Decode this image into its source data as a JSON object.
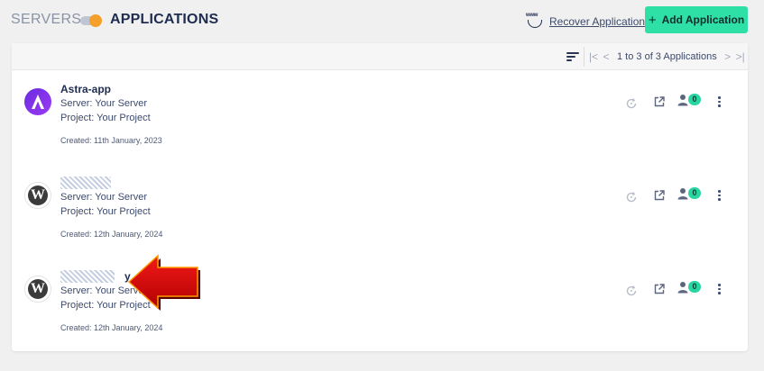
{
  "header": {
    "servers_label": "SERVERS",
    "applications_label": "APPLICATIONS",
    "recover_icon_text": "www",
    "recover_label": "Recover Application",
    "add_button_label": "Add Application",
    "add_button_plus": "+"
  },
  "toolbar": {
    "pagination_info": "1 to 3 of 3 Applications",
    "first_icon": "|<",
    "prev_icon": "<",
    "next_icon": ">",
    "last_icon": ">|"
  },
  "applications": [
    {
      "name": "Astra-app",
      "server": "Server: Your Server",
      "project": "Project: Your Project",
      "created": "Created: 11th January, 2023",
      "users_count": "0",
      "logo": "astra-logo"
    },
    {
      "name": "",
      "server": "Server: Your Server",
      "project": "Project: Your Project",
      "created": "Created: 12th January, 2024",
      "users_count": "0",
      "logo": "wordpress-logo"
    },
    {
      "name": "y",
      "server": "Server: Your Server",
      "project": "Project: Your Project",
      "created": "Created: 12th January, 2024",
      "users_count": "0",
      "logo": "wordpress-logo"
    }
  ],
  "colors": {
    "accent_green": "#2ee0a6",
    "toggle_orange": "#f4a02a",
    "astra_purple": "#7b32e8",
    "arrow_red": "#e00000"
  }
}
